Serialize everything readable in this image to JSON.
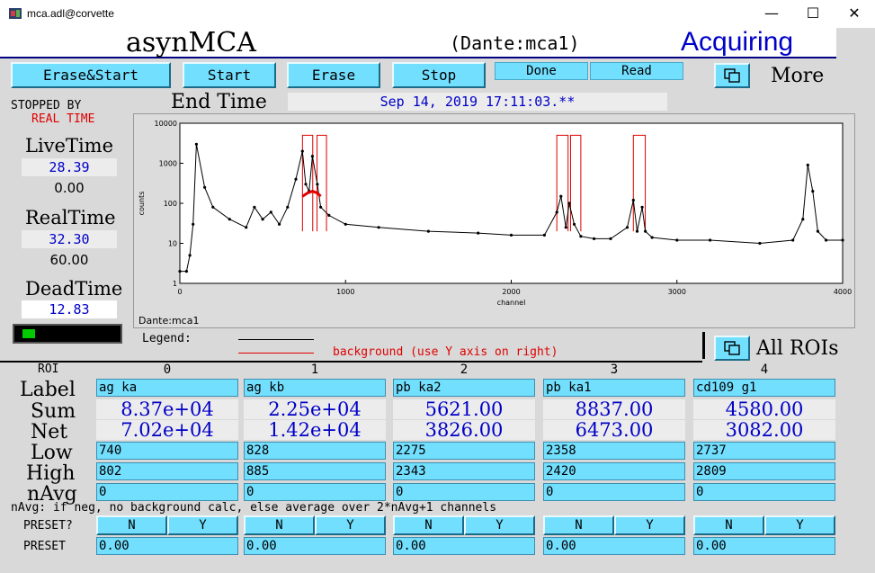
{
  "window": {
    "title": "mca.adl@corvette",
    "minimize": "—",
    "maximize": "☐",
    "close": "✕"
  },
  "header": {
    "app_title": "asynMCA",
    "device": "(Dante:mca1)",
    "status": "Acquiring",
    "status_color": "#0000c8"
  },
  "buttons": {
    "erase_start": "Erase&Start",
    "start": "Start",
    "erase": "Erase",
    "stop": "Stop",
    "done": "Done",
    "read": "Read",
    "more": "More",
    "all_rois": "All ROIs"
  },
  "status_panel": {
    "stopped_by": "STOPPED BY",
    "stopped_reason": "REAL TIME",
    "end_time_label": "End Time",
    "end_time": "Sep 14, 2019 17:11:03.**",
    "livetime_label": "LiveTime",
    "livetime_value": "28.39",
    "livetime_preset": "0.00",
    "realtime_label": "RealTime",
    "realtime_value": "32.30",
    "realtime_preset": "60.00",
    "deadtime_label": "DeadTime",
    "deadtime_value": "12.83",
    "deadtime_fraction": 0.13
  },
  "plot": {
    "name": "Dante:mca1",
    "legend_label": "Legend:",
    "legend_background": "background (use Y axis on right)",
    "ylabel": "counts",
    "xlabel": "channel",
    "x_ticks": [
      "0",
      "1000",
      "2000",
      "3000",
      "4000"
    ],
    "y_ticks": [
      "10000",
      "1000",
      "100",
      "10",
      "1"
    ]
  },
  "chart_data": {
    "type": "line",
    "xlabel": "channel",
    "ylabel": "counts",
    "xlim": [
      0,
      4000
    ],
    "ylim": [
      1,
      10000
    ],
    "y_scale": "log",
    "series": [
      {
        "name": "",
        "x": [
          0,
          40,
          60,
          80,
          100,
          150,
          200,
          300,
          400,
          450,
          500,
          550,
          600,
          650,
          700,
          740,
          760,
          780,
          800,
          830,
          850,
          900,
          1000,
          1200,
          1500,
          1800,
          2000,
          2200,
          2275,
          2300,
          2330,
          2350,
          2380,
          2420,
          2500,
          2600,
          2700,
          2737,
          2760,
          2790,
          2809,
          2850,
          3000,
          3200,
          3500,
          3700,
          3760,
          3790,
          3820,
          3850,
          3900,
          4000
        ],
        "y": [
          2,
          2,
          5,
          30,
          3000,
          250,
          80,
          40,
          25,
          80,
          40,
          60,
          30,
          80,
          400,
          2000,
          300,
          200,
          1500,
          300,
          80,
          50,
          30,
          25,
          20,
          18,
          16,
          16,
          60,
          150,
          25,
          100,
          30,
          15,
          13,
          13,
          25,
          120,
          20,
          80,
          20,
          14,
          12,
          12,
          10,
          12,
          40,
          900,
          200,
          20,
          12,
          12
        ]
      },
      {
        "name": "background",
        "x": [
          740,
          770,
          800,
          830,
          850
        ],
        "y": [
          150,
          180,
          200,
          180,
          150
        ]
      }
    ]
  },
  "roi_table": {
    "header": "ROI",
    "row_labels": [
      "Label",
      "Sum",
      "Net",
      "Low",
      "High",
      "nAvg"
    ],
    "columns": [
      {
        "index": "0",
        "label": "ag ka",
        "sum": "8.37e+04",
        "net": "7.02e+04",
        "low": "740",
        "high": "802",
        "navg": "0",
        "preset": "0.00"
      },
      {
        "index": "1",
        "label": "ag kb",
        "sum": "2.25e+04",
        "net": "1.42e+04",
        "low": "828",
        "high": "885",
        "navg": "0",
        "preset": "0.00"
      },
      {
        "index": "2",
        "label": "pb ka2",
        "sum": "5621.00",
        "net": "3826.00",
        "low": "2275",
        "high": "2343",
        "navg": "0",
        "preset": "0.00"
      },
      {
        "index": "3",
        "label": "pb ka1",
        "sum": "8837.00",
        "net": "6473.00",
        "low": "2358",
        "high": "2420",
        "navg": "0",
        "preset": "0.00"
      },
      {
        "index": "4",
        "label": "cd109 g1",
        "sum": "4580.00",
        "net": "3082.00",
        "low": "2737",
        "high": "2809",
        "navg": "0",
        "preset": "0.00"
      }
    ],
    "navg_note": "nAvg: if neg, no background calc, else average over 2*nAvg+1 channels",
    "preset_q_label": "PRESET?",
    "preset_label": "PRESET",
    "no": "N",
    "yes": "Y"
  }
}
